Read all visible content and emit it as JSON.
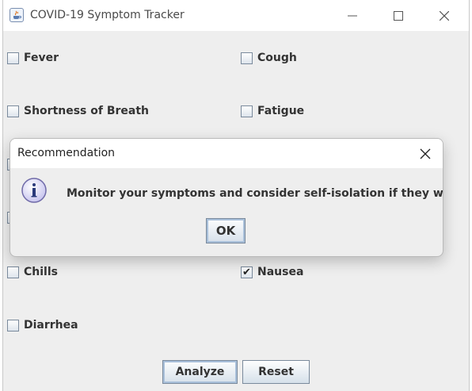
{
  "window": {
    "title": "COVID-19 Symptom Tracker",
    "icon": "java-cup-icon",
    "controls": [
      "minimize-icon",
      "maximize-icon",
      "close-icon"
    ]
  },
  "symptoms": [
    {
      "label": "Fever",
      "checked": false
    },
    {
      "label": "Cough",
      "checked": false
    },
    {
      "label": "Shortness of Breath",
      "checked": false
    },
    {
      "label": "Fatigue",
      "checked": false
    },
    {
      "label": "Chills",
      "checked": false
    },
    {
      "label": "Nausea",
      "checked": true
    },
    {
      "label": "Diarrhea",
      "checked": false
    }
  ],
  "buttons": {
    "analyze": "Analyze",
    "reset": "Reset"
  },
  "dialog": {
    "title": "Recommendation",
    "icon": "info-icon",
    "message": "Monitor your symptoms and consider self-isolation if they worsen.",
    "ok": "OK"
  },
  "colors": {
    "window_bg": "#eeeeee",
    "titlebar_bg": "#ffffff",
    "info_icon": "#2a3a7a"
  }
}
